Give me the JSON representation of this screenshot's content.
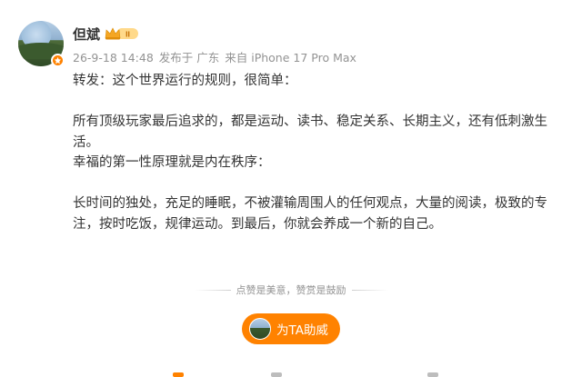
{
  "author": {
    "name": "但斌",
    "vip_level": "II"
  },
  "post_meta": {
    "timestamp": "26-9-18 14:48",
    "location": "发布于 广东",
    "source": "来自 iPhone 17 Pro Max"
  },
  "post": {
    "lines": [
      "转发：这个世界运行的规则，很简单：",
      "",
      "所有顶级玩家最后追求的，都是运动、读书、稳定关系、长期主义，还有低刺激生活。",
      "幸福的第一性原理就是内在秩序：",
      "",
      "长时间的独处，充足的睡眠，不被灌输周围人的任何观点，大量的阅读，极致的专注，按时吃饭，规律运动。到最后，你就会养成一个新的自己。"
    ]
  },
  "reward": {
    "divider_text": "点赞是美意，赞赏是鼓励",
    "button_label": "为TA助威"
  },
  "colors": {
    "accent": "#ff8200",
    "meta_text": "#939393",
    "body_text": "#333333"
  },
  "icons": [
    "verified-badge-icon",
    "vip-crown-icon"
  ]
}
